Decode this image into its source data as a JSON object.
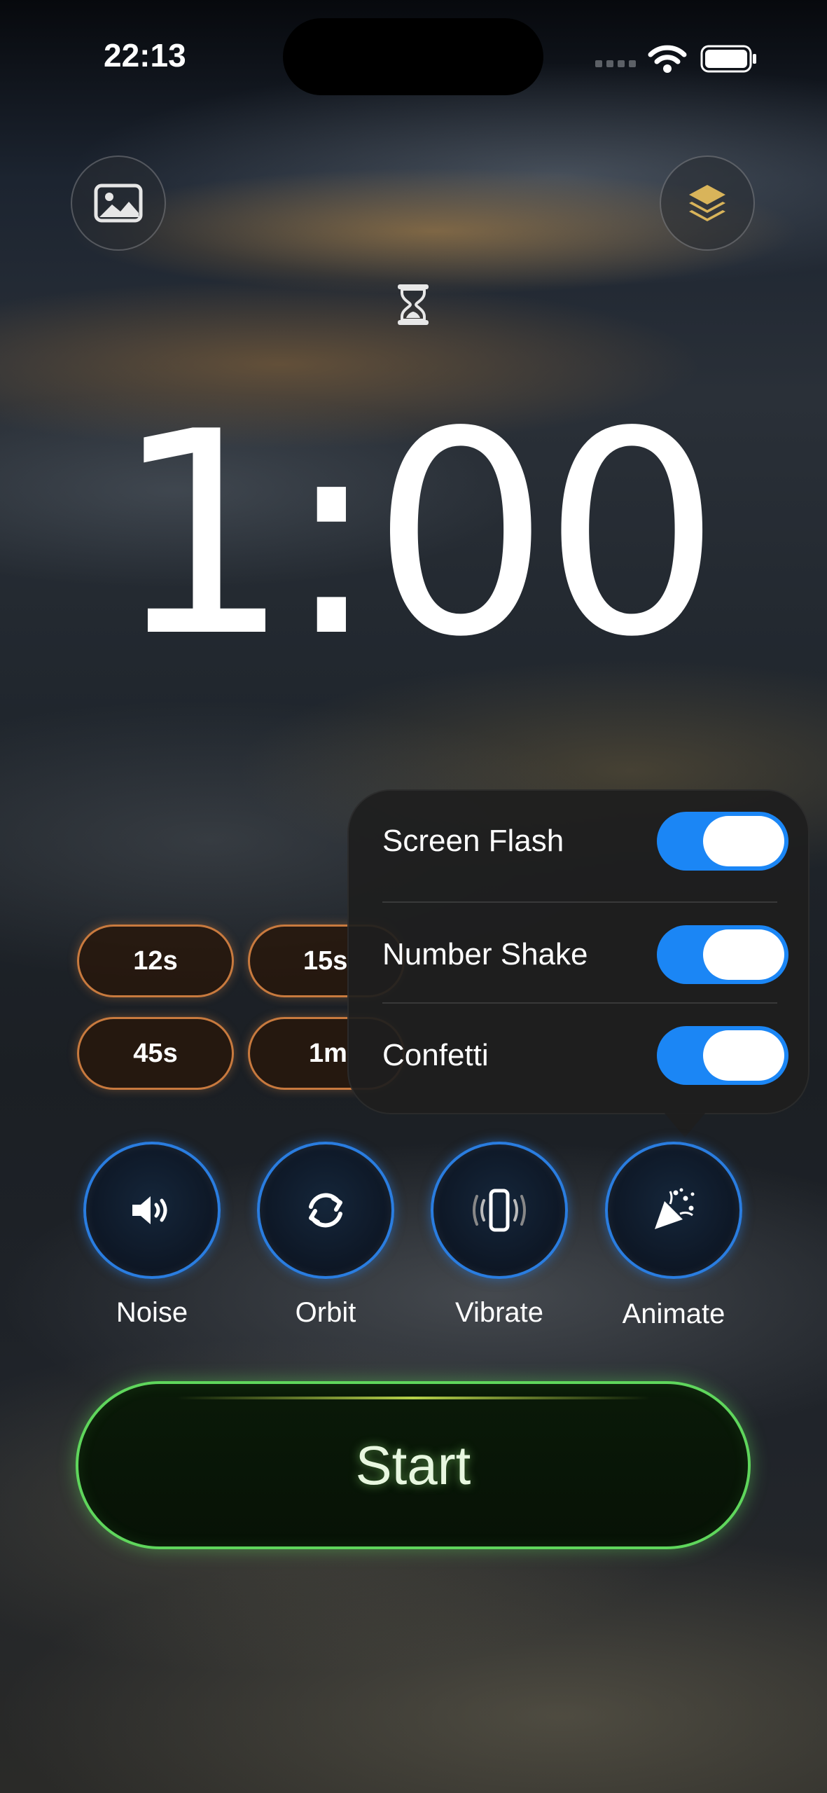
{
  "status_bar": {
    "time": "22:13"
  },
  "header": {
    "left_icon": "image-icon",
    "right_icon": "layers-icon",
    "timer_icon": "hourglass-icon"
  },
  "timer": {
    "display": "1:00"
  },
  "presets": [
    {
      "label": "12s"
    },
    {
      "label": "15s"
    },
    {
      "label": "45s"
    },
    {
      "label": "1m"
    }
  ],
  "animate_menu": {
    "items": [
      {
        "label": "Screen Flash",
        "enabled": true
      },
      {
        "label": "Number Shake",
        "enabled": true
      },
      {
        "label": "Confetti",
        "enabled": true
      }
    ],
    "toggle_color": "#1b86f5"
  },
  "options": [
    {
      "label": "Noise",
      "icon": "speaker-icon"
    },
    {
      "label": "Orbit",
      "icon": "orbit-icon"
    },
    {
      "label": "Vibrate",
      "icon": "vibrate-icon"
    },
    {
      "label": "Animate",
      "icon": "party-popper-icon"
    }
  ],
  "start_button": {
    "label": "Start",
    "accent": "#5fd65c"
  },
  "colors": {
    "preset_border": "#e68c46",
    "option_border": "#2a7de0"
  }
}
